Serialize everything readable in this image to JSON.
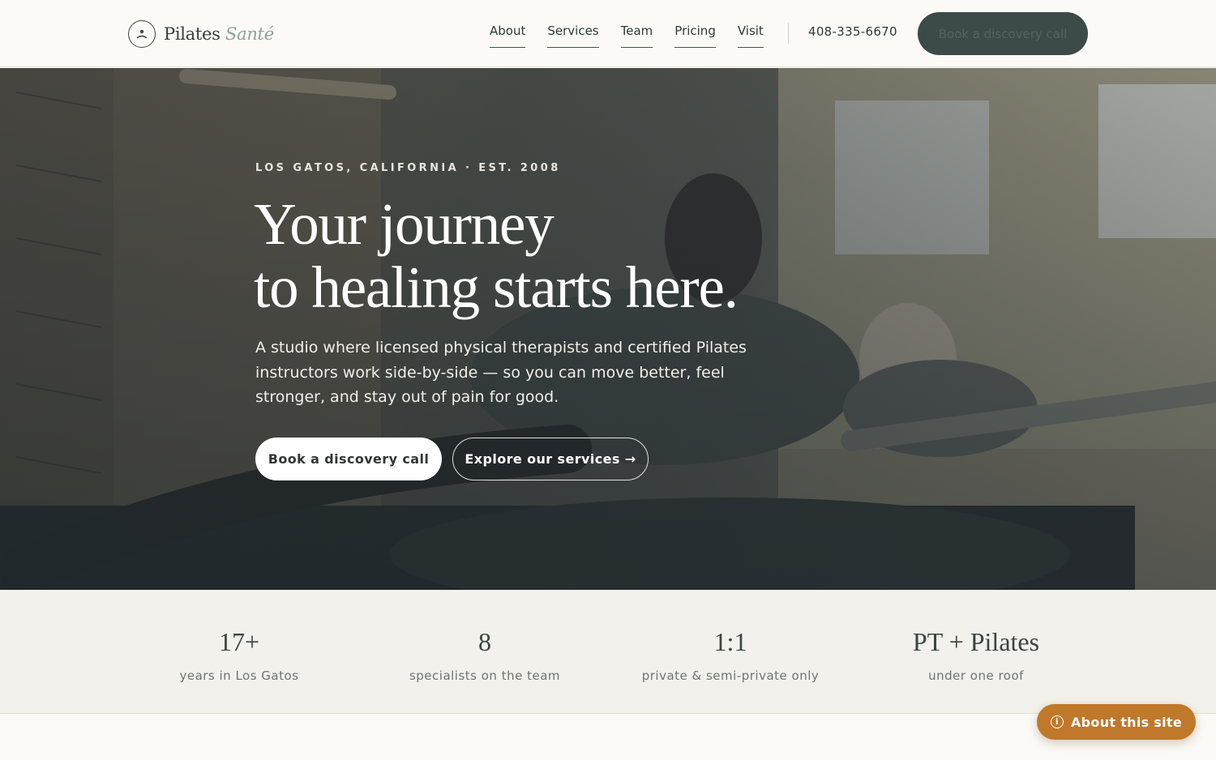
{
  "brand": {
    "name": "Pilates",
    "accent": "Santé",
    "icon": "person-circle-icon"
  },
  "nav": {
    "items": [
      {
        "label": "About"
      },
      {
        "label": "Services"
      },
      {
        "label": "Team"
      },
      {
        "label": "Pricing"
      },
      {
        "label": "Visit"
      }
    ],
    "phone": "408-335-6670",
    "cta_label": "Book a discovery call"
  },
  "hero": {
    "eyebrow": "LOS GATOS, CALIFORNIA · EST. 2008",
    "title_line1": "Your journey",
    "title_line2": "to healing starts here.",
    "subtitle": "A studio where licensed physical therapists and certified Pilates instructors work side-by-side — so you can move better, feel stronger, and stay out of pain for good.",
    "primary_cta": "Book a discovery call",
    "secondary_cta": "Explore our services →"
  },
  "stats": [
    {
      "value": "17+",
      "label": "years in Los Gatos"
    },
    {
      "value": "8",
      "label": "specialists on the team"
    },
    {
      "value": "1:1",
      "label": "private & semi-private only"
    },
    {
      "value": "PT + Pilates",
      "label": "under one roof"
    }
  ],
  "floating": {
    "label": "About this site",
    "icon": "info-icon"
  },
  "colors": {
    "primary_dark": "#3d4b48",
    "accent_sage": "#8ba39a",
    "badge_orange": "#c0782a",
    "stats_bg": "#f3f1eb"
  }
}
